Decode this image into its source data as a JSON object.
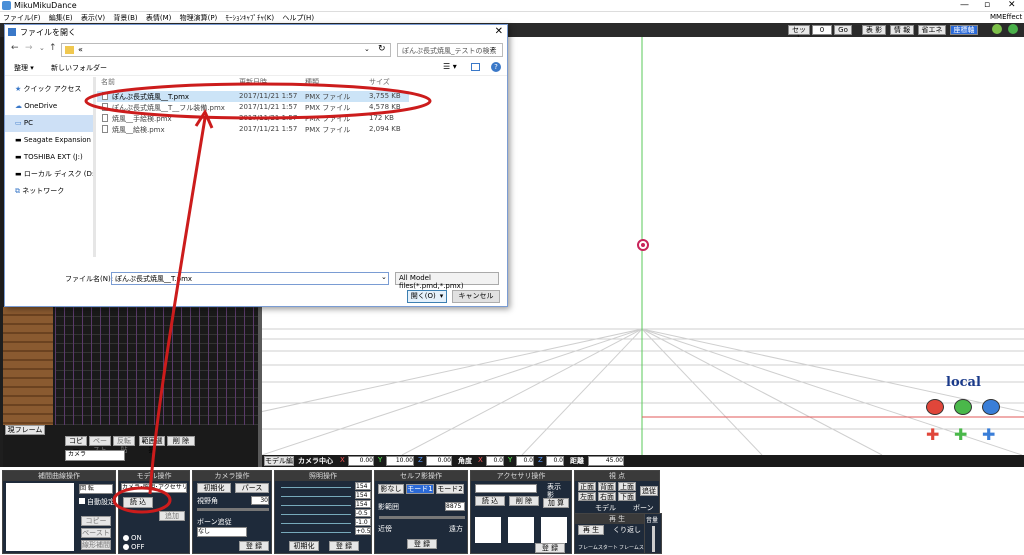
{
  "app": {
    "title": "MikuMikuDance",
    "menus": [
      "ファイル(F)",
      "編集(E)",
      "表示(V)",
      "背景(B)",
      "表情(M)",
      "物理演算(P)",
      "ﾓｰｼｮﾝｷｬﾌﾟﾁｬ(K)",
      "ヘルプ(H)"
    ],
    "effect_label": "MMEffect",
    "top_buttons": [
      "セット",
      "0",
      "Go",
      "表 影",
      "情 報",
      "省エネ",
      "座標軸"
    ]
  },
  "dialog": {
    "title": "ファイルを開く",
    "address": "«",
    "search_placeholder": "ぽんぷ長式焼風_テストの検索",
    "organize": "整理 ▾",
    "new_folder": "新しいフォルダー",
    "nav": [
      "クイック アクセス",
      "OneDrive",
      "PC",
      "Seagate Expansion Dr",
      "TOSHIBA EXT (J:)",
      "ローカル ディスク (D:)",
      "ネットワーク"
    ],
    "columns": [
      "名前",
      "更新日時",
      "種類",
      "サイズ"
    ],
    "files": [
      {
        "name": "ぽんぷ長式焼風__T.pmx",
        "date": "2017/11/21 1:57",
        "type": "PMX ファイル",
        "size": "3,755 KB"
      },
      {
        "name": "ぽんぷ長式焼風__T__フル装備.pmx",
        "date": "2017/11/21 1:57",
        "type": "PMX ファイル",
        "size": "4,578 KB"
      },
      {
        "name": "焼風__手絵検.pmx",
        "date": "2017/11/21 1:57",
        "type": "PMX ファイル",
        "size": "172 KB"
      },
      {
        "name": "焼風__絵検.pmx",
        "date": "2017/11/21 1:57",
        "type": "PMX ファイル",
        "size": "2,094 KB"
      }
    ],
    "filename_label": "ファイル名(N):",
    "filename_value": "ぽんぷ長式焼風__T.pmx",
    "filter": "All Model files(*.pmd,*.pmx)",
    "open": "開く(O)",
    "cancel": "キャンセル"
  },
  "viewport": {
    "local_label": "local"
  },
  "camera_bar": {
    "label_mode": "モデル編",
    "label_center": "カメラ中心",
    "x": "0.00",
    "y": "10.00",
    "z": "0.00",
    "label_angle": "角度",
    "ax": "0.0",
    "ay": "0.0",
    "az": "0.0",
    "label_dist": "距離",
    "dist": "45.00"
  },
  "timeline_bar": {
    "frame_label": "現フレーム",
    "copy": "コピー",
    "paste": "ペースト",
    "invert": "反転貼",
    "range_select": "範囲選択",
    "delete": "削 除",
    "camera_select": "カメラ"
  },
  "panels": {
    "interp": {
      "title": "補間曲線操作",
      "rotate": "回 転",
      "auto": "自動設定",
      "copy": "コピー",
      "paste": "ペースト",
      "linear": "線形補間"
    },
    "model": {
      "title": "モデル操作",
      "select": "カメラ･照明･アクセサリ",
      "load": "読 込",
      "on": "ON",
      "off": "OFF",
      "add": "追加"
    },
    "camera": {
      "title": "カメラ操作",
      "init": "初期化",
      "perspective": "パース",
      "fov_label": "視野角",
      "fov": "30",
      "follow_label": "ボーン追従",
      "follow": "なし",
      "register": "登 録"
    },
    "light": {
      "title": "照明操作",
      "r": "154",
      "g": "154",
      "b": "154",
      "x": "-0.5",
      "y": "-1.0",
      "z": "+0.5",
      "init": "初期化",
      "register": "登 録"
    },
    "shadow": {
      "title": "セルフ影操作",
      "none": "影なし",
      "mode1": "モード1",
      "mode2": "モード2",
      "range_label": "影範囲",
      "range": "8875",
      "near": "近傍",
      "far": "遠方",
      "register": "登 録"
    },
    "accessory": {
      "title": "アクセサリ操作",
      "load": "読 込",
      "delete": "削 除",
      "display": "表示",
      "shadow": "影",
      "add": "加 算",
      "register": "登 録"
    },
    "view": {
      "title": "視 点",
      "front": "正面",
      "back": "背面",
      "top": "上面",
      "track": "追従",
      "left": "左面",
      "right": "右面",
      "bottom": "下面",
      "model": "モデル",
      "bone": "ボーン"
    },
    "play": {
      "title": "再 生",
      "play": "再 生",
      "repeat": "くり返し",
      "start": "フレームスタート",
      "stop": "フレームストップ",
      "volume": "音量"
    }
  }
}
